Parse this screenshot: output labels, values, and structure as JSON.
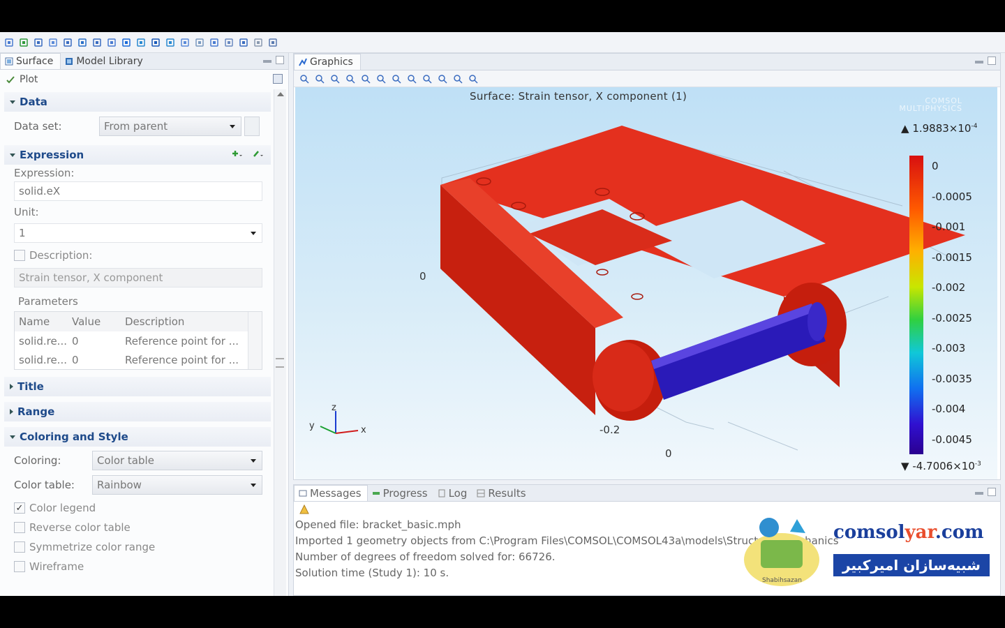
{
  "toolbar": {
    "icon_count": 19
  },
  "left_panel": {
    "tabs": [
      {
        "label": "Surface",
        "icon": "surface-icon"
      },
      {
        "label": "Model Library",
        "icon": "library-icon"
      }
    ],
    "plot_label": "Plot",
    "sections": {
      "data": {
        "title": "Data",
        "dataset_label": "Data set:",
        "dataset_value": "From parent"
      },
      "expression": {
        "title": "Expression",
        "expression_label": "Expression:",
        "expression_value": "solid.eX",
        "unit_label": "Unit:",
        "unit_value": "1",
        "description_label": "Description:",
        "description_value": "Strain tensor, X component"
      },
      "parameters": {
        "title": "Parameters",
        "columns": [
          "Name",
          "Value",
          "Description"
        ],
        "rows": [
          [
            "solid.re...",
            "0",
            "Reference point for ..."
          ],
          [
            "solid.re...",
            "0",
            "Reference point for ..."
          ]
        ]
      },
      "title_section": {
        "title": "Title"
      },
      "range_section": {
        "title": "Range"
      },
      "coloring": {
        "title": "Coloring and Style",
        "coloring_label": "Coloring:",
        "coloring_value": "Color table",
        "color_table_label": "Color table:",
        "color_table_value": "Rainbow",
        "checkboxes": [
          {
            "label": "Color legend",
            "checked": true
          },
          {
            "label": "Reverse color table",
            "checked": false
          },
          {
            "label": "Symmetrize color range",
            "checked": false
          },
          {
            "label": "Wireframe",
            "checked": false
          }
        ]
      }
    }
  },
  "graphics": {
    "tab_label": "Graphics",
    "plot_title": "Surface: Strain tensor, X component (1)",
    "logo": [
      "COMSOL",
      "MULTIPHYSICS"
    ],
    "axis_labels": {
      "left": "0",
      "bottom_a": "-0.2",
      "bottom_b": "0"
    },
    "triad": {
      "x": "x",
      "y": "y",
      "z": "z"
    },
    "colorbar": {
      "max_label": "1.9883×10",
      "max_exp": "-4",
      "min_label": "-4.7006×10",
      "min_exp": "-3",
      "ticks": [
        "0",
        "-0.0005",
        "-0.001",
        "-0.0015",
        "-0.002",
        "-0.0025",
        "-0.003",
        "-0.0035",
        "-0.004",
        "-0.0045"
      ]
    },
    "colors": {
      "body": "#e02414",
      "pin": "#2a1ab8"
    }
  },
  "messages": {
    "tabs": [
      "Messages",
      "Progress",
      "Log",
      "Results"
    ],
    "lines": [
      "Opened file: bracket_basic.mph",
      "Imported 1 geometry objects from C:\\Program Files\\COMSOL\\COMSOL43a\\models\\Structural_Mechanics",
      "Number of degrees of freedom solved for: 66726.",
      "Solution time (Study 1): 10 s."
    ]
  },
  "watermark": {
    "latin_a": "comsol",
    "latin_b": "yar",
    "latin_c": ".com",
    "persian": "شبیه‌سازان امیرکبیر",
    "badge": "Shabihsazan"
  }
}
